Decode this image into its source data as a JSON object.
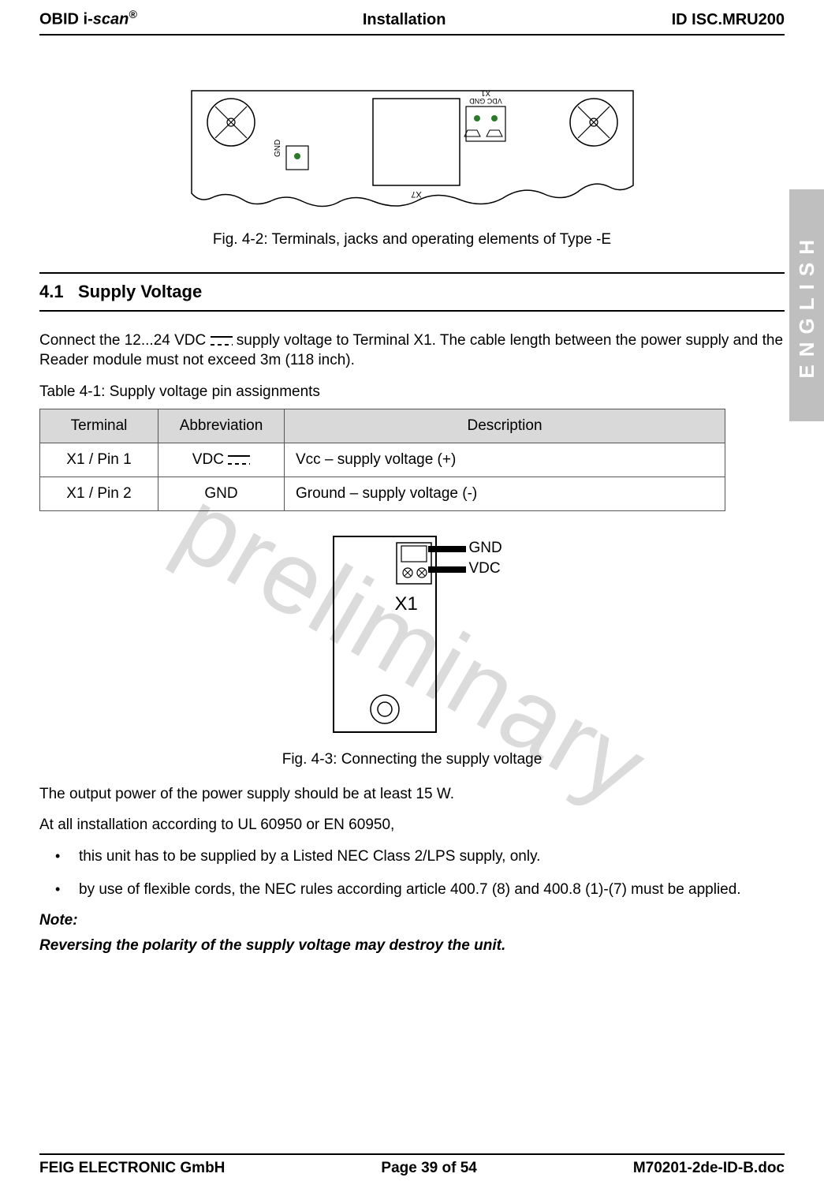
{
  "header": {
    "left_prefix": "OBID i-",
    "left_italic": "scan",
    "left_sup": "®",
    "middle": "Installation",
    "right": "ID ISC.MRU200"
  },
  "side_tab": "ENGLISH",
  "watermark": "preliminary",
  "fig42": {
    "caption": "Fig. 4-2: Terminals, jacks and operating elements of Type -E",
    "labels": {
      "x7": "X7",
      "gnd_side": "GND",
      "vdc_gnd": "VDC GND",
      "x1": "X1"
    }
  },
  "section": {
    "num": "4.1",
    "title": "Supply Voltage"
  },
  "para1_a": "Connect the 12...24 VDC ",
  "para1_b": " supply voltage to Terminal X1. The cable length between the power supply and the Reader module must not exceed 3m (118 inch).",
  "table": {
    "caption": "Table 4-1: Supply voltage pin assignments",
    "headers": {
      "c1": "Terminal",
      "c2": "Abbreviation",
      "c3": "Description"
    },
    "rows": [
      {
        "c1": "X1 / Pin 1",
        "c2": "VDC ",
        "c3": "Vcc – supply voltage  (+)",
        "dc": true
      },
      {
        "c1": "X1 / Pin 2",
        "c2": "GND",
        "c3": "Ground – supply voltage  (-)",
        "dc": false
      }
    ]
  },
  "fig43": {
    "caption": "Fig. 4-3: Connecting the supply voltage",
    "labels": {
      "gnd": "GND",
      "vdc": "VDC",
      "x1": "X1"
    }
  },
  "para2": "The output power of the power supply should be at least 15 W.",
  "para3": "At all installation according to UL 60950 or EN 60950,",
  "bullets": [
    "this unit has to be supplied by a Listed NEC Class 2/LPS supply, only.",
    "by use of flexible cords, the NEC rules according article 400.7 (8) and 400.8 (1)-(7) must be applied."
  ],
  "note_label": "Note:",
  "note_body": "Reversing the polarity of the supply voltage may destroy the unit.",
  "footer": {
    "left": "FEIG ELECTRONIC GmbH",
    "middle": "Page 39 of 54",
    "right": "M70201-2de-ID-B.doc"
  }
}
